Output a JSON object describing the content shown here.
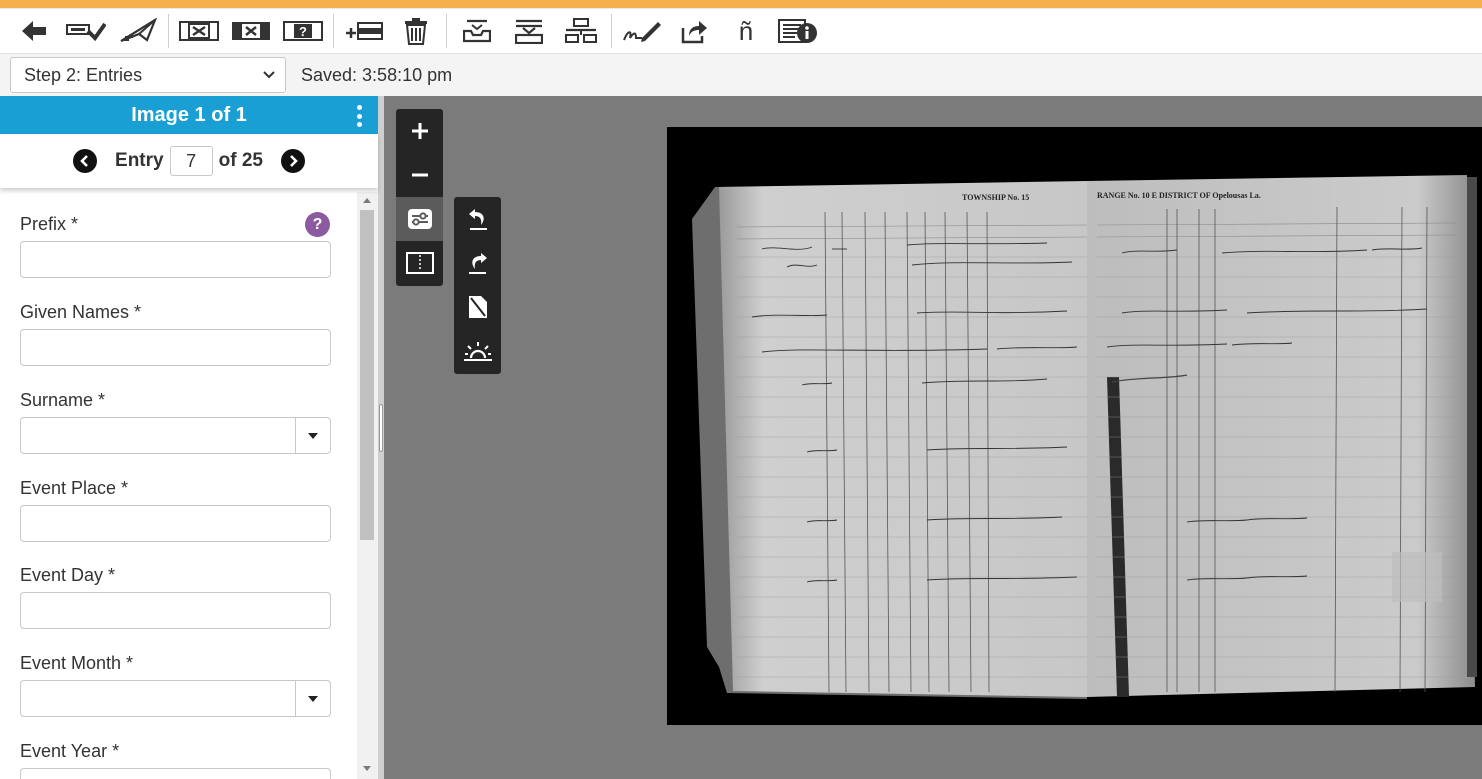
{
  "colors": {
    "accent": "#f4b04c",
    "header_blue": "#1a9fd5",
    "help_purple": "#8b5aa0",
    "viewer_bg": "#7b7b7b"
  },
  "toolbar": {
    "icons": [
      "back-arrow-icon",
      "submit-check-icon",
      "send-plane-icon",
      "blank-record-icon",
      "unreadable-record-icon",
      "questionable-record-icon",
      "add-record-icon",
      "delete-record-icon",
      "inbox-icon",
      "download-icon",
      "split-icon",
      "signature-icon",
      "share-icon",
      "special-character-icon",
      "field-info-icon"
    ],
    "special_char": "ñ"
  },
  "substep": {
    "step_selected": "Step 2: Entries",
    "saved_label": "Saved: 3:58:10 pm"
  },
  "sidebar": {
    "image_title": "Image 1 of 1",
    "entry_label": "Entry",
    "entry_value": "7",
    "entry_of": "of 25",
    "help_glyph": "?",
    "fields": [
      {
        "label": "Prefix *",
        "value": ""
      },
      {
        "label": "Given Names *",
        "value": ""
      },
      {
        "label": "Surname *",
        "value": ""
      },
      {
        "label": "Event Place *",
        "value": ""
      },
      {
        "label": "Event Day *",
        "value": ""
      },
      {
        "label": "Event Month *",
        "value": ""
      },
      {
        "label": "Event Year *",
        "value": ""
      }
    ]
  },
  "viewer": {
    "zoom_icons": [
      "zoom-in-icon",
      "zoom-out-icon",
      "adjust-sliders-icon",
      "split-view-icon"
    ],
    "adjust_icons": [
      "rotate-left-icon",
      "rotate-right-icon",
      "invert-icon",
      "brightness-icon"
    ],
    "record_header_left": "TOWNSHIP No. 15",
    "record_header_right": "RANGE No. 10 E DISTRICT OF Opelousas La."
  }
}
